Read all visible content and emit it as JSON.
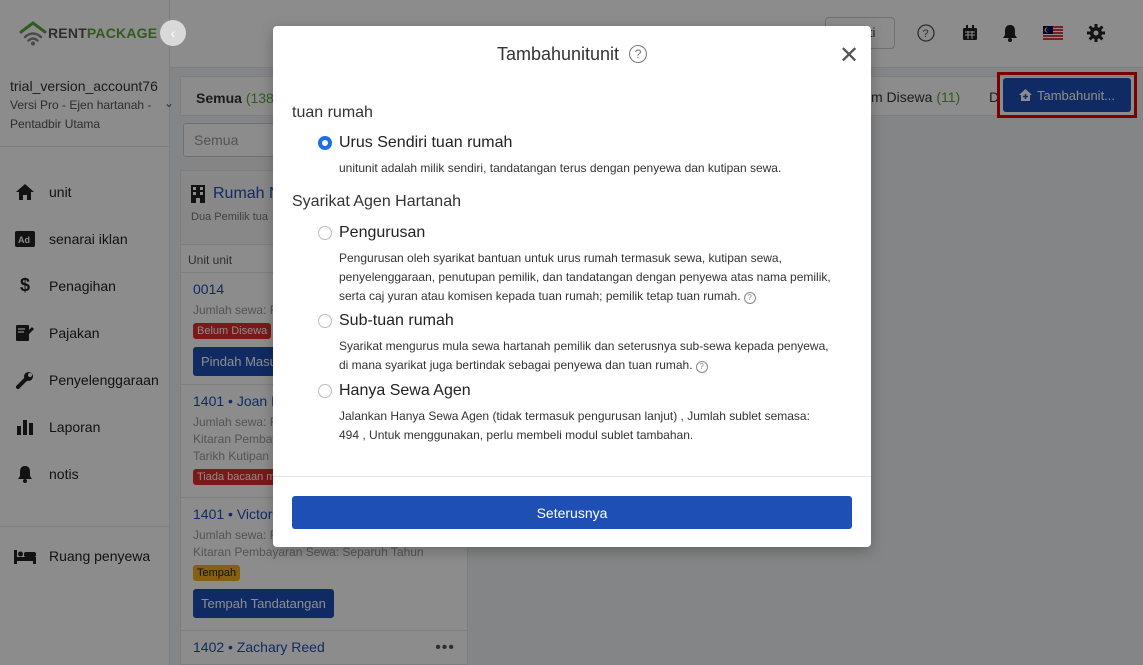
{
  "brand": {
    "part1": "RENT",
    "part2": "PACKAGE",
    "color_accent": "#5da63b"
  },
  "account": {
    "name": "trial_version_account76",
    "role": "Versi Pro - Ejen hartanah - Pentadbir Utama"
  },
  "nav": [
    {
      "label": "unit",
      "icon": "home-icon"
    },
    {
      "label": "senarai iklan",
      "icon": "ad-icon"
    },
    {
      "label": "Penagihan",
      "icon": "dollar-icon"
    },
    {
      "label": "Pajakan",
      "icon": "contract-icon"
    },
    {
      "label": "Penyelenggaraan",
      "icon": "wrench-icon"
    },
    {
      "label": "Laporan",
      "icon": "bar-chart-icon"
    },
    {
      "label": "notis",
      "icon": "bell-icon"
    }
  ],
  "nav_bottom": {
    "label": "Ruang penyewa",
    "icon": "bed-icon"
  },
  "topbar": {
    "button_label": "iti"
  },
  "tabs": {
    "all_label": "Semua",
    "all_count": "(138)",
    "rented_label": "m Disewa",
    "rented_count": "(11)",
    "d_label": "D"
  },
  "add_button": "Tambahunit...",
  "search": {
    "placeholder": "Semua"
  },
  "property": {
    "title": "Rumah N",
    "subtitle": "Dua Pemilik tua"
  },
  "list": {
    "col_head": "Unit unit",
    "units": [
      {
        "title": "0014",
        "lines": [
          "Jumlah sewa: R"
        ],
        "badge": "Belum Disewa",
        "badge_type": "red",
        "button": "Pindah Masuk"
      },
      {
        "title": "1401 • Joan R",
        "lines": [
          "Jumlah sewa: R",
          "Kitaran Pembay",
          "Tarikh Kutipan"
        ],
        "badge": "Tiada bacaan m",
        "badge_type": "red",
        "button": ""
      },
      {
        "title": "1401 • Victor",
        "lines": [
          "Jumlah sewa: R",
          "Kitaran Pembayaran Sewa: Separuh Tahun"
        ],
        "badge": "Tempah",
        "badge_type": "yellow",
        "button": "Tempah Tandatangan"
      },
      {
        "title": "1402 • Zachary Reed",
        "lines": [],
        "badge": "",
        "badge_type": "",
        "button": ""
      }
    ]
  },
  "modal": {
    "title": "Tambahunitunit",
    "section1": "tuan rumah",
    "option1": {
      "label": "Urus Sendiri tuan rumah",
      "desc": "unitunit adalah milik sendiri, tandatangan terus dengan penyewa dan kutipan sewa.",
      "selected": true
    },
    "section2": "Syarikat Agen Hartanah",
    "option2": {
      "label": "Pengurusan",
      "desc": "Pengurusan oleh syarikat bantuan untuk urus rumah termasuk sewa, kutipan sewa, penyelenggaraan, penutupan pemilik, dan tandatangan dengan penyewa atas nama pemilik, serta caj yuran atau komisen kepada tuan rumah; pemilik tetap tuan rumah.",
      "selected": false
    },
    "option3": {
      "label": "Sub-tuan rumah",
      "desc": "Syarikat mengurus mula sewa hartanah pemilik dan seterusnya sub-sewa kepada penyewa, di mana syarikat juga bertindak sebagai penyewa dan tuan rumah.",
      "selected": false
    },
    "option4": {
      "label": "Hanya Sewa Agen",
      "desc": "Jalankan Hanya Sewa Agen (tidak termasuk pengurusan lanjut) , Jumlah sublet semasa: 494 , Untuk menggunakan, perlu membeli modul sublet tambahan.",
      "selected": false
    },
    "next_button": "Seterusnya"
  }
}
